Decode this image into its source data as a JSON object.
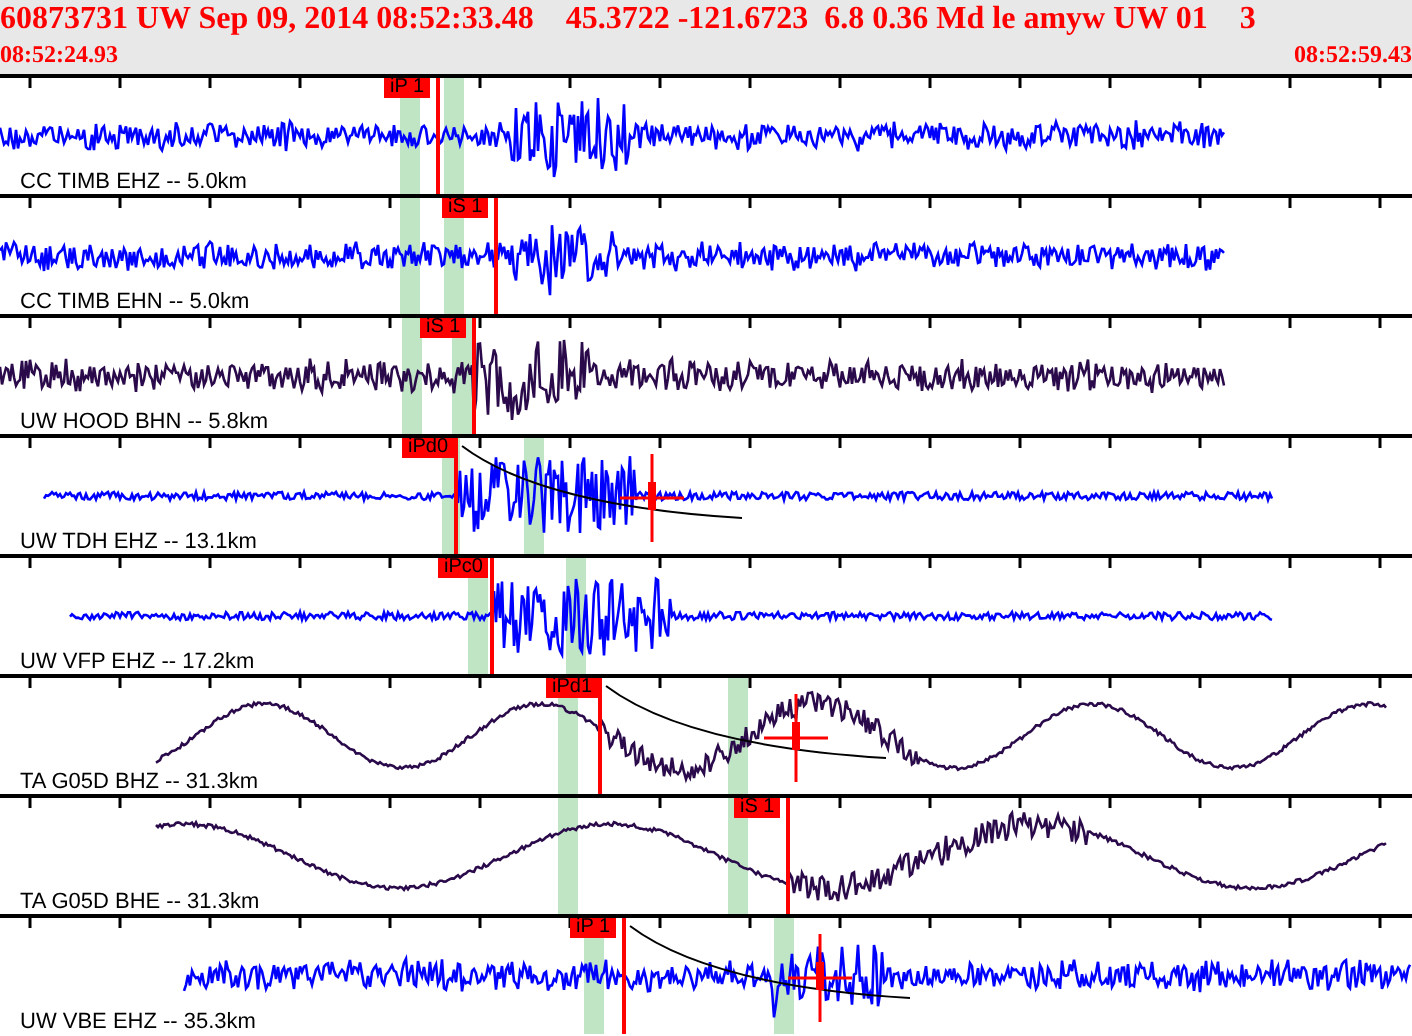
{
  "header": {
    "title": "60873731 UW Sep 09, 2014 08:52:33.48    45.3722 -121.6723  6.8 0.36 Md le amyw UW 01    3",
    "start_time": "08:52:24.93",
    "end_time": "08:52:59.43"
  },
  "traces": [
    {
      "label": "CC TIMB EHZ -- 5.0km",
      "pick": "iP 1",
      "color": "#0000ff"
    },
    {
      "label": "CC TIMB EHN -- 5.0km",
      "pick": "iS 1",
      "color": "#0000ff"
    },
    {
      "label": "UW HOOD BHN -- 5.8km",
      "pick": "iS 1",
      "color": "#2a0a4a"
    },
    {
      "label": "UW TDH EHZ -- 13.1km",
      "pick": "iPd0",
      "color": "#0000ff"
    },
    {
      "label": "UW VFP EHZ -- 17.2km",
      "pick": "iPc0",
      "color": "#0000ff"
    },
    {
      "label": "TA G05D BHZ -- 31.3km",
      "pick": "iPd1",
      "color": "#2a0a4a"
    },
    {
      "label": "TA G05D BHE -- 31.3km",
      "pick": "iS 1",
      "color": "#2a0a4a"
    },
    {
      "label": "UW VBE EHZ -- 35.3km",
      "pick": "iP 1",
      "color": "#0000ff"
    }
  ]
}
